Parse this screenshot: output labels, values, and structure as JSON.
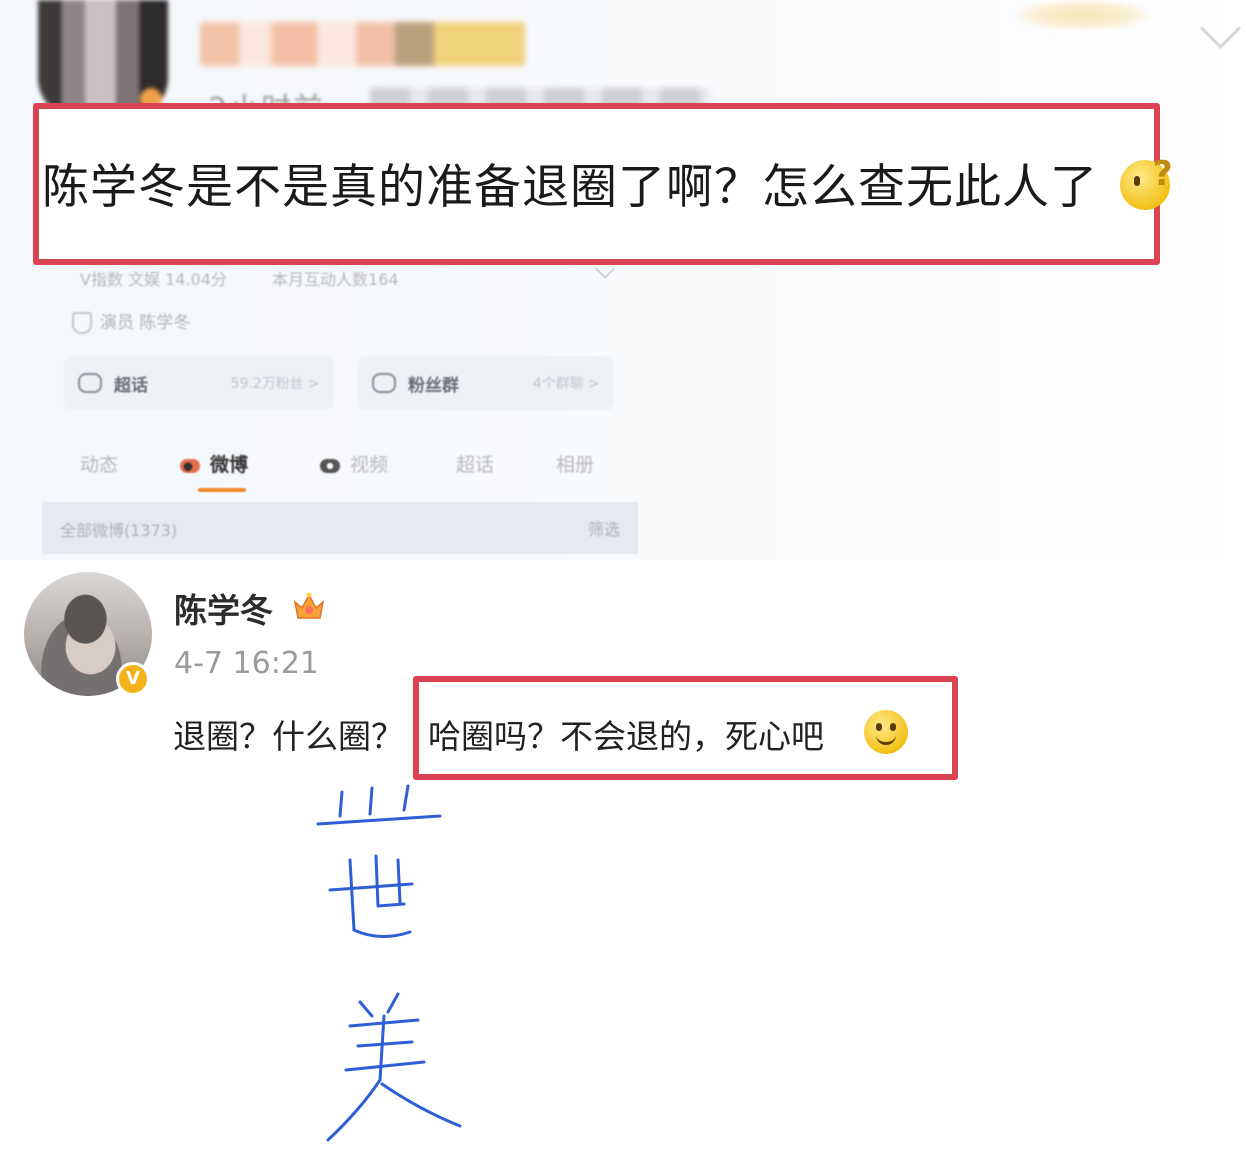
{
  "original_post": {
    "time_ago": "2小时前",
    "text": "陈学冬是不是真的准备退圈了啊？怎么查无此人了",
    "emoji": "thinking-face-icon"
  },
  "profile": {
    "stats": [
      "V指数 文娱 14.04分",
      "本月互动人数164"
    ],
    "role": "演员 陈学冬",
    "cards": [
      {
        "label": "超话",
        "sub": "59.2万粉丝 >"
      },
      {
        "label": "粉丝群",
        "sub": "4个群聊 >"
      }
    ],
    "tabs": [
      "动态",
      "微博",
      "视频",
      "超话",
      "相册"
    ],
    "active_tab": "微博",
    "filter_left": "全部微博(1373)",
    "filter_right": "筛选"
  },
  "reply": {
    "name": "陈学冬",
    "time": "4-7 16:21",
    "verified": "V",
    "text_part1": "退圈？什么圈？",
    "text_part2": "哈圈吗？不会退的，死心吧",
    "emoji": "smile-icon"
  },
  "colors": {
    "highlight": "#d94352",
    "handwriting": "#2f5fd6",
    "badge": "#f5b31b"
  }
}
